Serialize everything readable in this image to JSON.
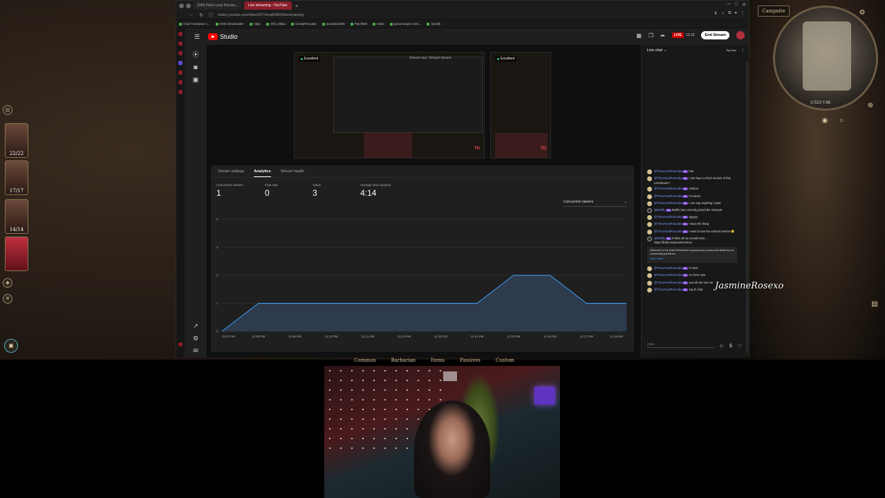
{
  "browser": {
    "tabs": [
      {
        "label": "(296) How's your first wa..."
      },
      {
        "label": "Live streaming - YouTube"
      }
    ],
    "url": "studio.youtube.com/video/DCYwoqEWtK0/livestreaming",
    "bookmarks": [
      "Chat Translator A...",
      "VOD Downloader",
      "Clips",
      "Shiri_Milaa",
      "UnrealPancake",
      "pumpkin2806",
      "PatchW8",
      "mkati",
      "justonceapex Stre...",
      "Spotify"
    ]
  },
  "studio": {
    "brand": "Studio",
    "live_label": "LIVE",
    "live_time": "12:19",
    "end_stream": "End Stream"
  },
  "previews": {
    "status": "Excellent",
    "stream_key": "Stream key: Default stream",
    "tag": "TU"
  },
  "analytics": {
    "tabs": [
      "Stream settings",
      "Analytics",
      "Stream health"
    ],
    "active_tab": "Analytics",
    "metrics": [
      {
        "label": "Concurrent viewers",
        "value": "1"
      },
      {
        "label": "Chat rate",
        "value": "0"
      },
      {
        "label": "Views",
        "value": "3"
      },
      {
        "label": "Average view duration",
        "value": "4:14"
      }
    ],
    "metric_select": "Concurrent viewers"
  },
  "chart_data": {
    "type": "area",
    "x": [
      "11:07 PM",
      "11:08 PM",
      "11:09 PM",
      "11:10 PM",
      "11:11 PM",
      "11:12 PM",
      "11:13 PM",
      "11:14 PM",
      "11:15 PM",
      "11:16 PM",
      "11:17 PM",
      "11:18 PM"
    ],
    "points": [
      {
        "x": 0,
        "y": 0
      },
      {
        "x": 1,
        "y": 1
      },
      {
        "x": 7,
        "y": 1
      },
      {
        "x": 8,
        "y": 2
      },
      {
        "x": 9,
        "y": 2
      },
      {
        "x": 10,
        "y": 1
      },
      {
        "x": 11.1,
        "y": 1
      }
    ],
    "ylim": [
      0,
      4
    ],
    "yticks": [
      "0",
      "1",
      "2",
      "3",
      "4"
    ],
    "grid": true,
    "color": "#3ea6ff"
  },
  "chat": {
    "title": "Live chat",
    "top_fans": "Top fans",
    "input_placeholder": "Chat...",
    "welcome": "Welcome to live chat! Remember to guard your privacy and abide by our community guidelines.",
    "learn_more": "Learn more",
    "messages": [
      {
        "user": "@TheUnrealPancake",
        "badge": "#1",
        "text": "huh"
      },
      {
        "user": "@TheUnrealPancake",
        "badge": "#1",
        "text": "I can have a short version of this Livestream?"
      },
      {
        "user": "@TheUnrealPancake",
        "badge": "#1",
        "text": "vertical"
      },
      {
        "user": "@TheUnrealPancake",
        "badge": "#1",
        "text": "I'm alone"
      },
      {
        "user": "@TheUnrealPancake",
        "badge": "#1",
        "text": "I can say anything I want"
      },
      {
        "user": "@Botfilx",
        "badge": "#2",
        "text": "Botfilx has correctly joined the channel!"
      },
      {
        "user": "@TheUnrealPancake",
        "badge": "#1",
        "text": "ayyyyy"
      },
      {
        "user": "@TheUnrealPancake",
        "badge": "#1",
        "text": "I have the thing"
      },
      {
        "user": "@TheUnrealPancake",
        "badge": "#1",
        "text": "I want to see the vertical version 😀"
      },
      {
        "user": "@Botfilx",
        "badge": "#2",
        "text": "Follow all my socials here → https://linktr.ee/jasminerosexo"
      },
      {
        "user": "@TheUnrealPancake",
        "badge": "#1",
        "text": "hi chat"
      },
      {
        "user": "@TheUnrealPancake",
        "badge": "#1",
        "text": "I'm here now"
      },
      {
        "user": "@TheUnrealPancake",
        "badge": "#1",
        "text": "you all can see me"
      },
      {
        "user": "@TheUnrealPancake",
        "badge": "#1",
        "text": "say hi chat"
      }
    ]
  },
  "overlay_name": "JasmineRosexo",
  "game": {
    "campsite": "Campsite",
    "map_coords": "X:523 Y:66",
    "party_hp": [
      "22/22",
      "17/17",
      "14/14",
      ""
    ],
    "tabs": [
      "Common",
      "Barbarian",
      "Items",
      "Passives",
      "Custom"
    ]
  }
}
